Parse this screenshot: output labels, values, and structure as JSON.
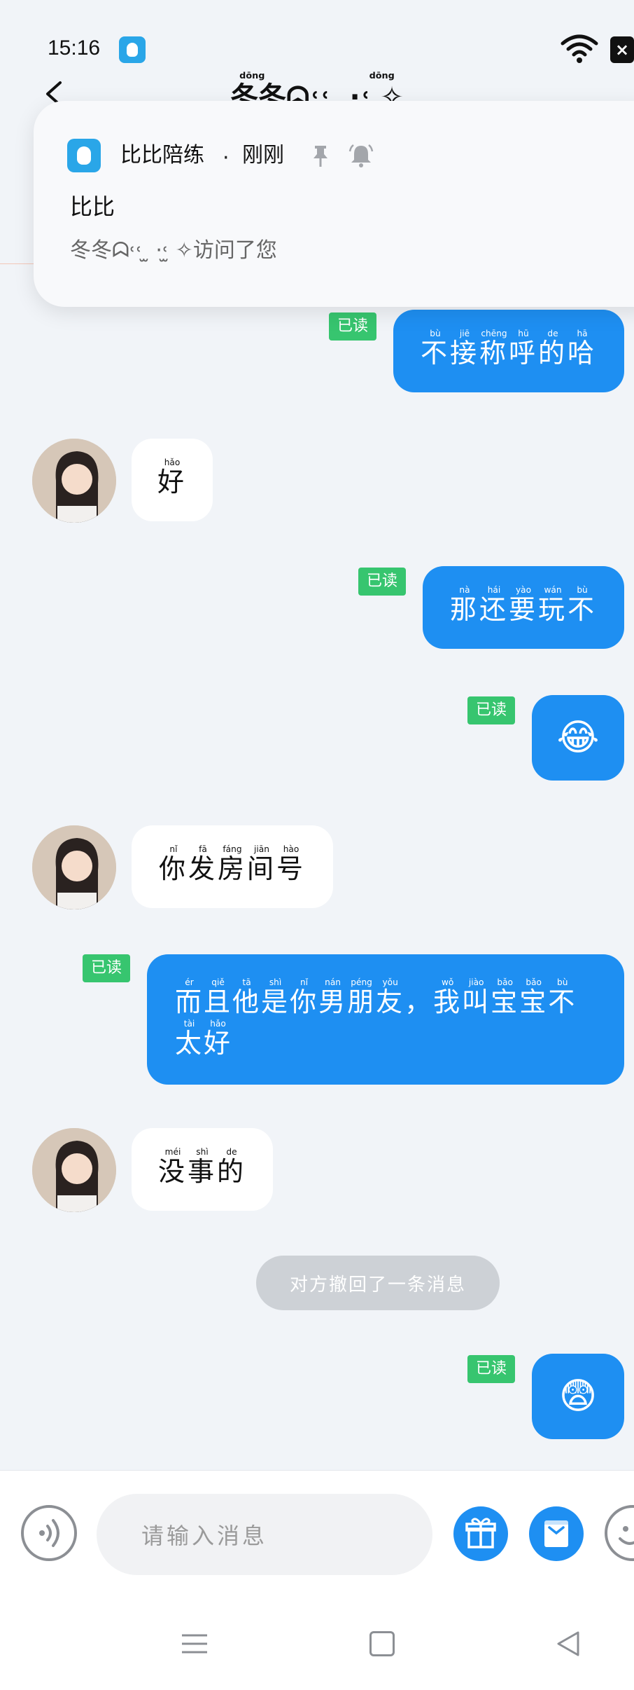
{
  "status_bar": {
    "time": "15:16"
  },
  "header": {
    "title": "冬冬ᗣ˓˓ ̫ ·˓̫ ✧",
    "title_pinyin": "dōng dōng"
  },
  "notification": {
    "app_name": "比比陪练",
    "separator": "·",
    "time": "刚刚",
    "title": "比比",
    "body": "冬冬ᗣ˓˓ ̫ ·˓̫ ✧访问了您"
  },
  "messages": [
    {
      "side": "out",
      "text": "不接称呼的哈",
      "read_label": "已读"
    },
    {
      "side": "in",
      "text": "好"
    },
    {
      "side": "out",
      "text": "那还要玩不",
      "read_label": "已读"
    },
    {
      "side": "out",
      "emoji": "😂",
      "read_label": "已读"
    },
    {
      "side": "in",
      "text": "你发房间号"
    },
    {
      "side": "out",
      "text": "而且他是你男朋友，我叫宝宝不太好",
      "read_label": "已读"
    },
    {
      "side": "in",
      "text": "没事的"
    },
    {
      "side": "out",
      "emoji": "😨",
      "read_label": "已读"
    }
  ],
  "recall_notice": "对方撤回了一条消息",
  "input": {
    "placeholder": "请输入消息"
  },
  "colors": {
    "accent": "#1e8ff2",
    "read_badge": "#37c56f",
    "background": "#f1f4f8"
  },
  "icons": [
    "back-icon",
    "pin-icon",
    "bell-icon",
    "voice-icon",
    "gift-icon",
    "order-icon",
    "emoji-icon",
    "nav-menu-icon",
    "nav-home-icon",
    "nav-back-icon"
  ]
}
